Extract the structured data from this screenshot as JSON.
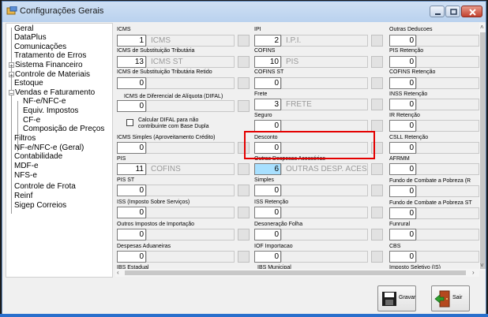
{
  "window": {
    "title": "Configurações Gerais"
  },
  "tree": [
    {
      "label": "Geral"
    },
    {
      "label": "DataPlus"
    },
    {
      "label": "Comunicações"
    },
    {
      "label": "Tratamento de Erros"
    },
    {
      "label": "Sistema Financeiro"
    },
    {
      "label": "Controle de Materiais"
    },
    {
      "label": "Estoque"
    },
    {
      "label": "Vendas e Faturamento"
    },
    {
      "label": "NF-e/NFC-e"
    },
    {
      "label": "Equiv. Impostos"
    },
    {
      "label": "CF-e"
    },
    {
      "label": "Composição de Preços"
    },
    {
      "label": "Filtros"
    },
    {
      "label": "NF-e/NFC-e (Geral)"
    },
    {
      "label": "Contabilidade"
    },
    {
      "label": "MDF-e"
    },
    {
      "label": "NFS-e"
    },
    {
      "label": "Controle de Frota"
    },
    {
      "label": "Reinf"
    },
    {
      "label": "Sigep Correios"
    }
  ],
  "col1": [
    {
      "label": "ICMS",
      "value": "1",
      "desc": "ICMS"
    },
    {
      "label": "ICMS de Substituição Tributária",
      "value": "13",
      "desc": "ICMS ST"
    },
    {
      "label": "ICMS de Substituição Tributária Retido",
      "value": "0"
    },
    {
      "label": "ICMS de Diferencial de Alíquota (DIFAL)",
      "value": "0"
    },
    {
      "label": "ICMS Simples (Aproveitamento Crédito)",
      "value": "0"
    },
    {
      "label": "PIS",
      "value": "11",
      "desc": "COFINS"
    },
    {
      "label": "PIS ST",
      "value": "0"
    },
    {
      "label": "ISS (Imposto Sobre Serviços)",
      "value": "0"
    },
    {
      "label": "Outros Impostos de Importação",
      "value": "0"
    },
    {
      "label": "Despesas Aduaneiras",
      "value": "0"
    },
    {
      "label": "IBS Estadual"
    }
  ],
  "difal_checkbox": {
    "line1": "Calcular DIFAL para não",
    "line2": "contribuinte com Base Dupla"
  },
  "col2": [
    {
      "label": "IPI",
      "value": "2",
      "desc": "I.P.I."
    },
    {
      "label": "COFINS",
      "value": "10",
      "desc": "PIS"
    },
    {
      "label": "COFINS ST",
      "value": "0"
    },
    {
      "label": "Frete",
      "value": "3",
      "desc": "FRETE"
    },
    {
      "label": "Seguro",
      "value": "0"
    },
    {
      "label": "Desconto",
      "value": "0"
    },
    {
      "label": "Outras Despesas Acessórias",
      "value": "6",
      "desc": "OUTRAS DESP. ACESSÓ"
    },
    {
      "label": "Simples",
      "value": "0"
    },
    {
      "label": "ISS Retenção",
      "value": "0"
    },
    {
      "label": "Desoneração Folha",
      "value": "0"
    },
    {
      "label": "IOF Importacao",
      "value": "0"
    },
    {
      "label": "IBS Municipal"
    }
  ],
  "col3": [
    {
      "label": "Outras Deducoes",
      "value": "0"
    },
    {
      "label": "PIS Retenção",
      "value": "0"
    },
    {
      "label": "COFINS Retenção",
      "value": "0"
    },
    {
      "label": "INSS Retenção",
      "value": "0"
    },
    {
      "label": "IR Retenção",
      "value": "0"
    },
    {
      "label": "CSLL Retenção",
      "value": "0"
    },
    {
      "label": "AFRMM",
      "value": "0"
    },
    {
      "label": "Fundo de Combate a Pobreza (R",
      "value": "0"
    },
    {
      "label": "Fundo de Combate a Pobreza ST",
      "value": "0"
    },
    {
      "label": "Funrural",
      "value": "0"
    },
    {
      "label": "CBS",
      "value": "0"
    },
    {
      "label": "Imposto Seletivo (IS)"
    }
  ],
  "buttons": {
    "save": "Gravar",
    "exit": "Sair"
  },
  "colors": {
    "highlight": "#e40000",
    "selected_field": "#a8e0ff"
  }
}
